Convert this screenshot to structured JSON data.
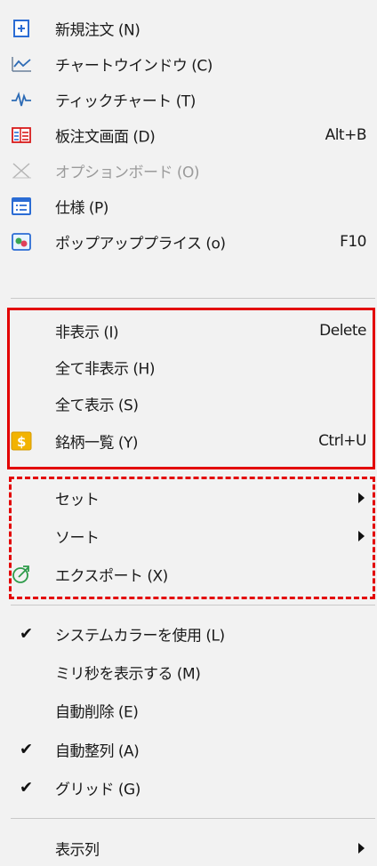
{
  "menu": {
    "items": [
      {
        "label": "新規注文 (N)",
        "shortcut": "",
        "icon": "new-order-icon"
      },
      {
        "label": "チャートウインドウ (C)",
        "shortcut": "",
        "icon": "chart-window-icon"
      },
      {
        "label": "ティックチャート (T)",
        "shortcut": "",
        "icon": "tick-chart-icon"
      },
      {
        "label": "板注文画面 (D)",
        "shortcut": "Alt+B",
        "icon": "order-board-icon"
      },
      {
        "label": "オプションボード (O)",
        "shortcut": "",
        "icon": "option-board-icon",
        "disabled": true
      },
      {
        "label": "仕様 (P)",
        "shortcut": "",
        "icon": "specification-icon"
      },
      {
        "label": "ポップアッププライス (o)",
        "shortcut": "F10",
        "icon": "popup-price-icon"
      },
      {
        "label": "非表示 (I)",
        "shortcut": "Delete"
      },
      {
        "label": "全て非表示 (H)",
        "shortcut": ""
      },
      {
        "label": "全て表示 (S)",
        "shortcut": ""
      },
      {
        "label": "銘柄一覧 (Y)",
        "shortcut": "Ctrl+U",
        "icon": "symbol-list-icon"
      },
      {
        "label": "セット",
        "submenu": true
      },
      {
        "label": "ソート",
        "submenu": true
      },
      {
        "label": "エクスポート (X)",
        "shortcut": "",
        "icon": "export-icon"
      },
      {
        "label": "システムカラーを使用 (L)",
        "checked": true
      },
      {
        "label": "ミリ秒を表示する (M)",
        "checked": false
      },
      {
        "label": "自動削除 (E)",
        "checked": false
      },
      {
        "label": "自動整列 (A)",
        "checked": true
      },
      {
        "label": "グリッド (G)",
        "checked": true
      },
      {
        "label": "表示列",
        "submenu": true
      }
    ]
  },
  "colors": {
    "highlight_border": "#e30000",
    "menu_background": "#f2f2f2",
    "disabled_text": "#9b9b9b"
  }
}
